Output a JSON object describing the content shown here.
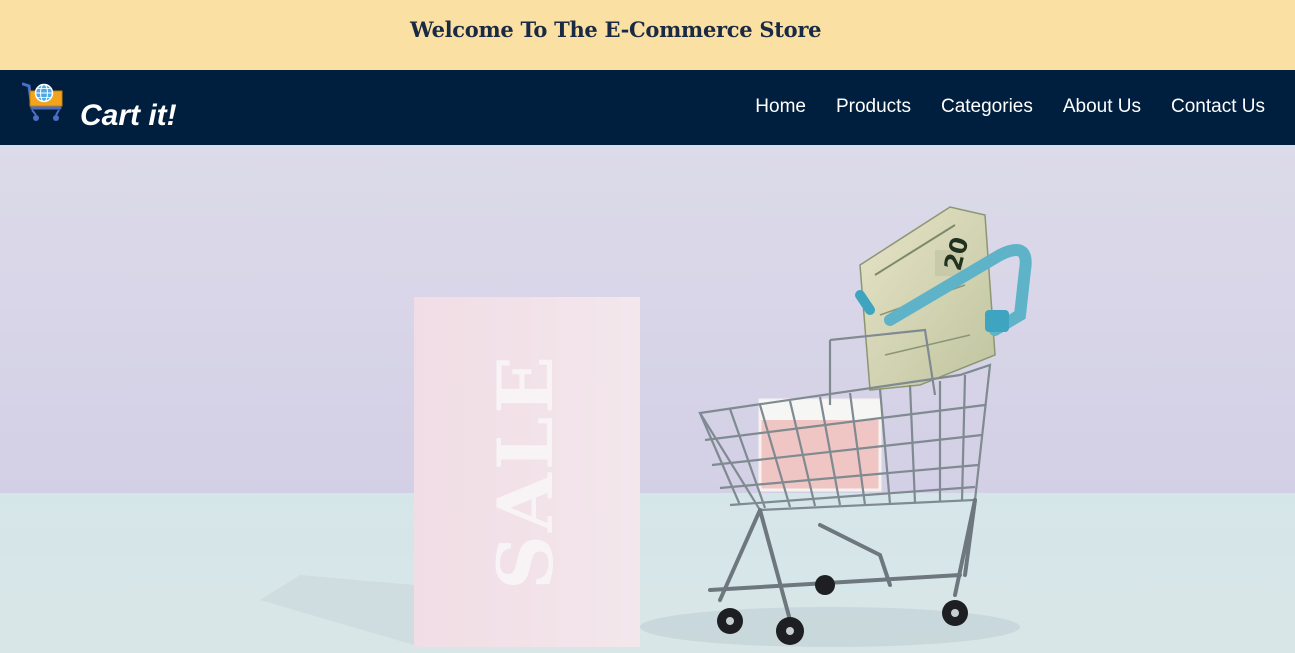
{
  "banner": {
    "title": "Welcome To The E-Commerce Store"
  },
  "navbar": {
    "brand": "Cart it!",
    "logo_icon": "shopping-cart-globe-icon",
    "links": [
      {
        "label": "Home"
      },
      {
        "label": "Products"
      },
      {
        "label": "Categories"
      },
      {
        "label": "About Us"
      },
      {
        "label": "Contact Us"
      }
    ]
  },
  "hero": {
    "sale_card_text": "SALE",
    "banknote_value": "20"
  },
  "colors": {
    "banner_bg": "#fae0a2",
    "navbar_bg": "#001f3f",
    "hero_wall": "#d8d6ea",
    "hero_floor": "#d6e6e8"
  }
}
